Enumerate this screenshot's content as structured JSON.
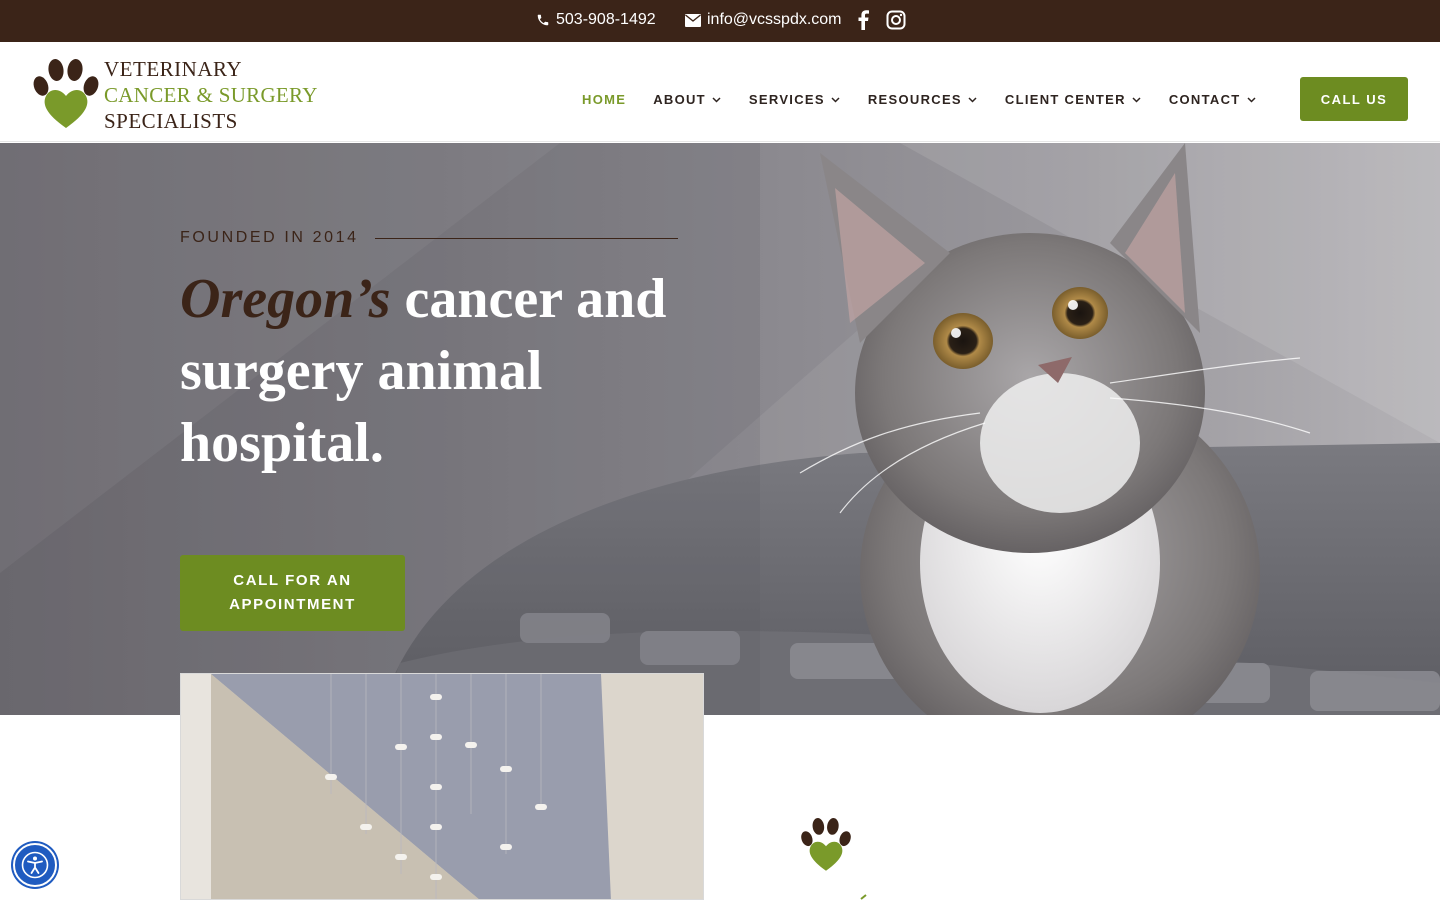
{
  "topbar": {
    "phone": "503-908-1492",
    "email": "info@vcsspdx.com",
    "icons": [
      "phone-icon",
      "envelope-icon",
      "facebook-icon",
      "instagram-icon"
    ]
  },
  "header": {
    "logo": {
      "line1": "VETERINARY",
      "line2": "CANCER & SURGERY",
      "line3": "SPECIALISTS"
    },
    "nav": {
      "home": "HOME",
      "about": "ABOUT",
      "services": "SERVICES",
      "resources": "RESOURCES",
      "client_center": "CLIENT CENTER",
      "contact": "CONTACT"
    },
    "call_us": "CALL US"
  },
  "hero": {
    "founded": "FOUNDED IN 2014",
    "headline_em": "Oregon’s",
    "headline_rest": " cancer and surgery animal hospital.",
    "cta": "CALL FOR AN APPOINTMENT"
  },
  "colors": {
    "brown": "#3b2418",
    "green": "#6d8c21",
    "accessibility_blue": "#1f5bc0"
  }
}
